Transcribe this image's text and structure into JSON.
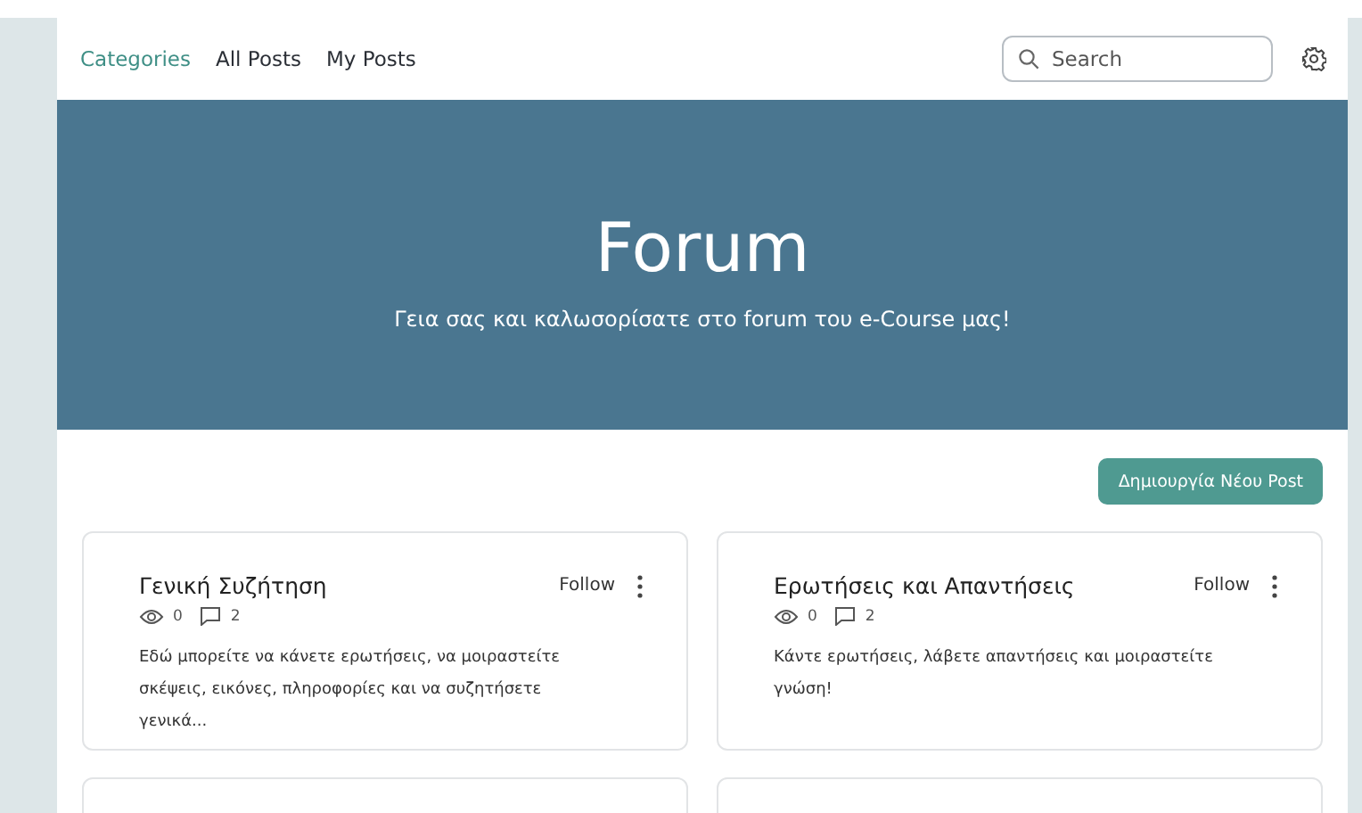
{
  "nav": {
    "tabs": [
      {
        "label": "Categories",
        "selected": true
      },
      {
        "label": "All Posts",
        "selected": false
      },
      {
        "label": "My Posts",
        "selected": false
      }
    ],
    "search": {
      "placeholder": "Search"
    }
  },
  "banner": {
    "title": "Forum",
    "subtitle": "Γεια σας και καλωσορίσατε στο forum του e-Course μας!"
  },
  "new_post_button": "Δημιουργία Νέου Post",
  "categories": [
    {
      "kind": "category",
      "title": "Γενική Συζήτηση",
      "follow": "Follow",
      "views": "0",
      "comments": "2",
      "description": "Εδώ μπορείτε να κάνετε ερωτήσεις, να μοιραστείτε σκέψεις, εικόνες, πληροφορίες και να συζητήσετε γενικά..."
    },
    {
      "kind": "category",
      "title": "Ερωτήσεις και Απαντήσεις",
      "follow": "Follow",
      "views": "0",
      "comments": "2",
      "description": "Κάντε ερωτήσεις, λάβετε απαντήσεις και μοιραστείτε γνώση!"
    },
    {
      "kind": "partial"
    },
    {
      "kind": "partial"
    }
  ]
}
